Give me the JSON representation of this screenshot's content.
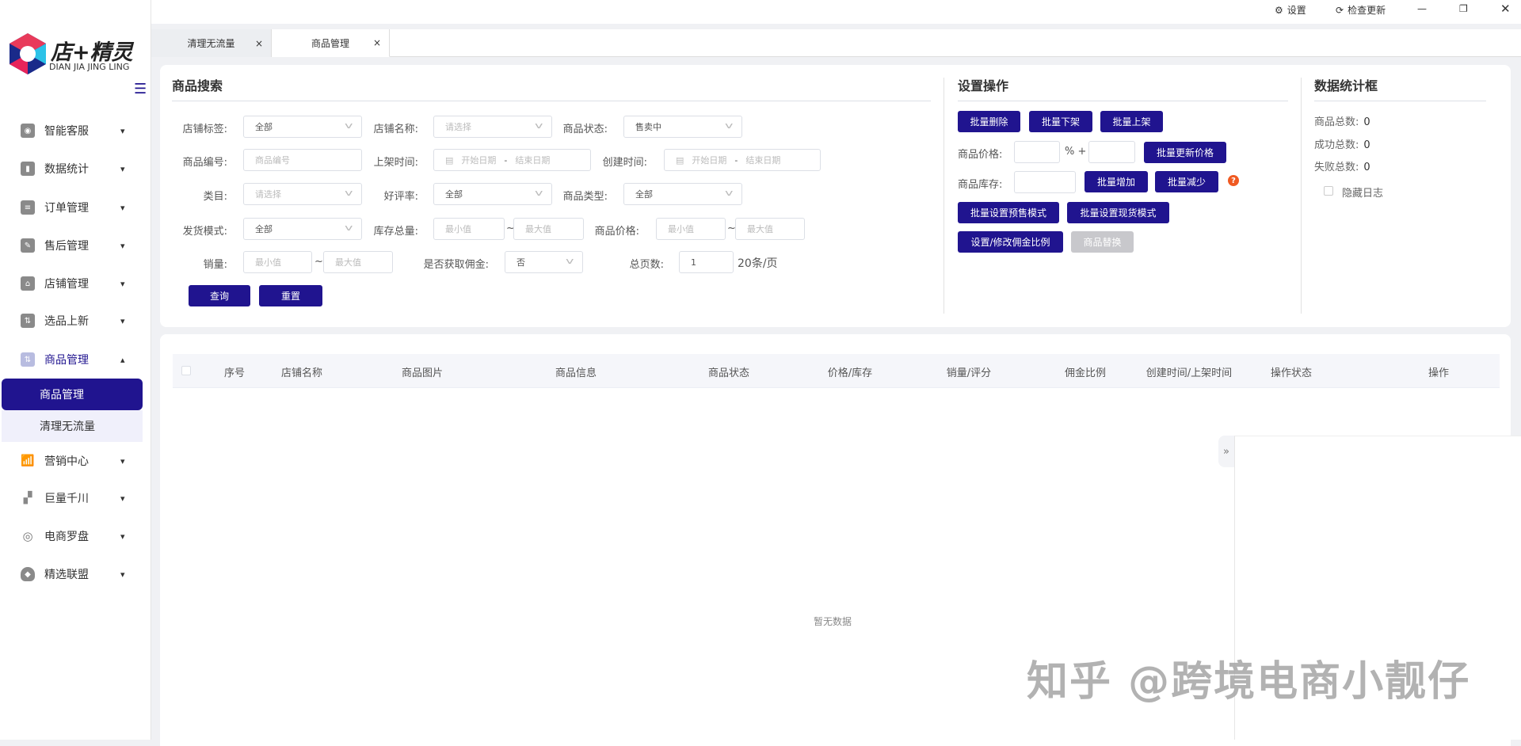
{
  "app": {
    "logo_text": "店+精灵",
    "logo_sub": "DIAN JIA JING LING"
  },
  "topbar": {
    "settings": "设置",
    "check_update": "检查更新"
  },
  "sidebar": {
    "items": [
      {
        "label": "智能客服",
        "icon": "robot-icon"
      },
      {
        "label": "数据统计",
        "icon": "bar-chart-icon"
      },
      {
        "label": "订单管理",
        "icon": "clipboard-icon"
      },
      {
        "label": "售后管理",
        "icon": "edit-doc-icon"
      },
      {
        "label": "店铺管理",
        "icon": "store-icon"
      },
      {
        "label": "选品上新",
        "icon": "sort-icon"
      },
      {
        "label": "商品管理",
        "icon": "sort-icon"
      },
      {
        "label": "营销中心",
        "icon": "growth-chart-icon"
      },
      {
        "label": "巨量千川",
        "icon": "signal-icon"
      },
      {
        "label": "电商罗盘",
        "icon": "compass-icon"
      },
      {
        "label": "精选联盟",
        "icon": "shield-icon"
      }
    ],
    "submenu": [
      {
        "label": "商品管理",
        "active": true
      },
      {
        "label": "清理无流量",
        "active": false
      }
    ]
  },
  "tabs": [
    {
      "label": "清理无流量",
      "active": false
    },
    {
      "label": "商品管理",
      "active": true
    }
  ],
  "search": {
    "title": "商品搜索",
    "shop_tag": {
      "label": "店铺标签:",
      "value": "全部"
    },
    "shop_name": {
      "label": "店铺名称:",
      "placeholder": "请选择"
    },
    "status": {
      "label": "商品状态:",
      "value": "售卖中"
    },
    "product_no": {
      "label": "商品编号:",
      "placeholder": "商品编号"
    },
    "listed_time": {
      "label": "上架时间:",
      "start": "开始日期",
      "end": "结束日期"
    },
    "created_time": {
      "label": "创建时间:",
      "start": "开始日期",
      "end": "结束日期"
    },
    "category": {
      "label": "类目:",
      "placeholder": "请选择"
    },
    "rating": {
      "label": "好评率:",
      "value": "全部"
    },
    "type": {
      "label": "商品类型:",
      "value": "全部"
    },
    "ship_mode": {
      "label": "发货模式:",
      "value": "全部"
    },
    "stock": {
      "label": "库存总量:",
      "min": "最小值",
      "max": "最大值"
    },
    "price": {
      "label": "商品价格:",
      "min": "最小值",
      "max": "最大值"
    },
    "sales": {
      "label": "销量:",
      "min": "最小值",
      "max": "最大值"
    },
    "commission": {
      "label": "是否获取佣金:",
      "value": "否"
    },
    "pages": {
      "label": "总页数:",
      "value": "1",
      "unit": "20条/页"
    },
    "tilde": "~",
    "dash": "-",
    "query": "查询",
    "reset": "重置"
  },
  "ops": {
    "title": "设置操作",
    "batch_delete": "批量删除",
    "batch_off": "批量下架",
    "batch_on": "批量上架",
    "price_label": "商品价格:",
    "pct": "% +",
    "update_price": "批量更新价格",
    "stock_label": "商品库存:",
    "inc": "批量增加",
    "dec": "批量减少",
    "help": "?",
    "presale": "批量设置预售模式",
    "spot": "批量设置现货模式",
    "commission": "设置/修改佣金比例",
    "replace": "商品替换"
  },
  "stats": {
    "title": "数据统计框",
    "total_label": "商品总数:",
    "total": "0",
    "success_label": "成功总数:",
    "success": "0",
    "fail_label": "失败总数:",
    "fail": "0",
    "hide_log": "隐藏日志"
  },
  "table": {
    "columns": [
      "序号",
      "店铺名称",
      "商品图片",
      "商品信息",
      "商品状态",
      "价格/库存",
      "销量/评分",
      "佣金比例",
      "创建时间/上架时间",
      "操作状态",
      "操作"
    ],
    "empty": "暂无数据"
  },
  "watermark": "知乎 @跨境电商小靓仔",
  "colors": {
    "accent": "#20148f",
    "submenu_bg": "#f0f0fb",
    "help": "#f05a22"
  }
}
